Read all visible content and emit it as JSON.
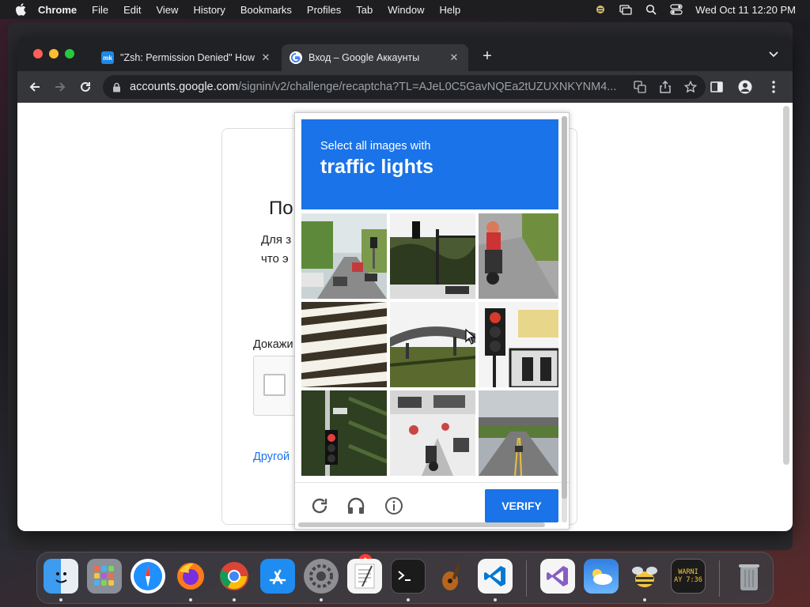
{
  "menubar": {
    "items": [
      "Chrome",
      "File",
      "Edit",
      "View",
      "History",
      "Bookmarks",
      "Profiles",
      "Tab",
      "Window",
      "Help"
    ],
    "clock": "Wed Oct 11  12:20 PM"
  },
  "tabs": [
    {
      "title": "\"Zsh: Permission Denied\" How",
      "favicon": "mk",
      "active": false
    },
    {
      "title": "Вход – Google Аккаунты",
      "favicon": "google-icon",
      "active": true
    }
  ],
  "omnibox": {
    "host": "accounts.google.com",
    "path": "/signin/v2/challenge/recaptcha?TL=AJeL0C5GavNQEa2tUZUXNKYNM4..."
  },
  "page": {
    "title_partial": "По",
    "subtitle_partial": "Для з что э",
    "prove_label_partial": "Докажи",
    "other_link_partial": "Другой"
  },
  "challenge": {
    "instruction": "Select all images with",
    "target": "traffic lights",
    "verify_label": "VERIFY",
    "tiles": [
      {
        "scene": "street-with-cars"
      },
      {
        "scene": "traffic-signal-pole"
      },
      {
        "scene": "motorcycle-road"
      },
      {
        "scene": "crosswalk-stripes"
      },
      {
        "scene": "overpass"
      },
      {
        "scene": "traffic-light-closeup"
      },
      {
        "scene": "traffic-light-building"
      },
      {
        "scene": "busy-intersection"
      },
      {
        "scene": "highway-bridge"
      }
    ]
  },
  "dock": {
    "apps": [
      "Finder",
      "Launchpad",
      "Safari",
      "Firefox",
      "Chrome",
      "App Store",
      "System Settings",
      "TextEdit",
      "Terminal",
      "Instruments",
      "VS Code",
      "Visual Studio",
      "Weather",
      "Cyberduck",
      "Console"
    ],
    "settings_badge": "1",
    "console_text": "WARNI AY 7:36"
  }
}
